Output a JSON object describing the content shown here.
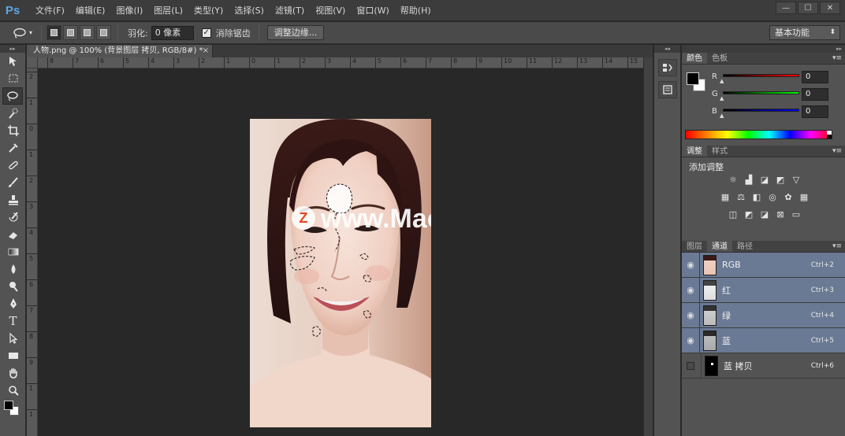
{
  "app": {
    "logo": "Ps"
  },
  "menu": [
    "文件(F)",
    "编辑(E)",
    "图像(I)",
    "图层(L)",
    "类型(Y)",
    "选择(S)",
    "滤镜(T)",
    "视图(V)",
    "窗口(W)",
    "帮助(H)"
  ],
  "window_controls": {
    "minimize": "—",
    "maximize": "☐",
    "close": "✕"
  },
  "options": {
    "feather_label": "羽化:",
    "feather_value": "0 像素",
    "antialias_label": "消除锯齿",
    "antialias_checked": "✓",
    "refine_edge_button": "调整边缘...",
    "workspace": "基本功能"
  },
  "document": {
    "tab_title": "人物.png @ 100% (背景图层 拷贝, RGB/8#) *",
    "tab_close": "×",
    "watermark": "www.MacZ.com",
    "watermark_badge": "Z"
  },
  "rulers": {
    "h_labels": [
      "8",
      "7",
      "6",
      "5",
      "4",
      "3",
      "2",
      "1",
      "0",
      "1",
      "2",
      "3",
      "4",
      "5",
      "6",
      "7",
      "8",
      "9",
      "10",
      "11",
      "12",
      "13",
      "14",
      "15"
    ],
    "v_labels": [
      "2",
      "1",
      "0",
      "1",
      "2",
      "3",
      "4",
      "5",
      "6",
      "7",
      "8",
      "9",
      "1",
      "1"
    ]
  },
  "color_panel": {
    "tabs": [
      "颜色",
      "色板"
    ],
    "channels": [
      {
        "label": "R",
        "value": "0",
        "color": "#ff0000"
      },
      {
        "label": "G",
        "value": "0",
        "color": "#00ff00"
      },
      {
        "label": "B",
        "value": "0",
        "color": "#0000ff"
      }
    ],
    "foreground": "#000000",
    "background": "#ffffff"
  },
  "adjustments_panel": {
    "tabs": [
      "调整",
      "样式"
    ],
    "title": "添加调整"
  },
  "channels_panel": {
    "tabs": [
      "图层",
      "通道",
      "路径"
    ],
    "rows": [
      {
        "name": "RGB",
        "shortcut": "Ctrl+2",
        "selected": true,
        "visible": true
      },
      {
        "name": "红",
        "shortcut": "Ctrl+3",
        "selected": true,
        "visible": true
      },
      {
        "name": "绿",
        "shortcut": "Ctrl+4",
        "selected": true,
        "visible": true
      },
      {
        "name": "蓝",
        "shortcut": "Ctrl+5",
        "selected": true,
        "visible": true
      },
      {
        "name": "蓝 拷贝",
        "shortcut": "Ctrl+6",
        "selected": false,
        "visible": false
      }
    ]
  },
  "icons": {
    "lasso": "lasso-icon",
    "eye": "eye-icon",
    "panel_menu": "panel-menu-icon"
  }
}
